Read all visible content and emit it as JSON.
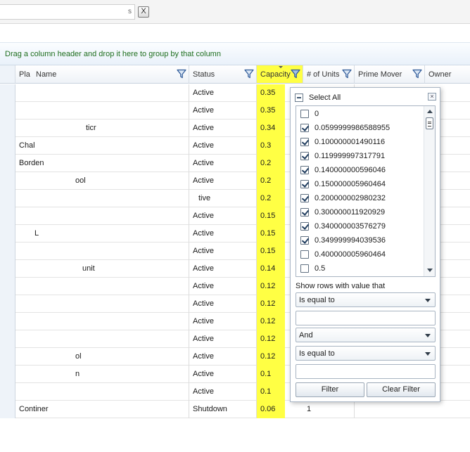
{
  "toolbar": {
    "search_value": "s",
    "clear_label": "X"
  },
  "group_panel": {
    "text": "Drag a column header and drop it here to group by that column"
  },
  "columns": {
    "plant": "Pla",
    "name": "Name",
    "status": "Status",
    "capacity": "Capacity",
    "units": "# of Units",
    "prime_mover": "Prime Mover",
    "owner": "Owner"
  },
  "rows": [
    {
      "name": "",
      "status": "Active",
      "capacity": "0.35",
      "units": ""
    },
    {
      "name": "",
      "status": "Active",
      "capacity": "0.35",
      "units": ""
    },
    {
      "name": "ticr",
      "status": "Active",
      "capacity": "0.34",
      "units": ""
    },
    {
      "name": "Chal",
      "status": "Active",
      "capacity": "0.3",
      "units": ""
    },
    {
      "name": "Borden",
      "status": "Active",
      "capacity": "0.2",
      "units": ""
    },
    {
      "name": "ool",
      "status": "Active",
      "capacity": "0.2",
      "units": ""
    },
    {
      "name": "",
      "status": "tive",
      "capacity": "0.2",
      "units": ""
    },
    {
      "name": "",
      "status": "Active",
      "capacity": "0.15",
      "units": ""
    },
    {
      "name": "L",
      "status": "Active",
      "capacity": "0.15",
      "units": ""
    },
    {
      "name": "",
      "status": "Active",
      "capacity": "0.15",
      "units": ""
    },
    {
      "name": "unit",
      "status": "Active",
      "capacity": "0.14",
      "units": ""
    },
    {
      "name": "",
      "status": "Active",
      "capacity": "0.12",
      "units": ""
    },
    {
      "name": "",
      "status": "Active",
      "capacity": "0.12",
      "units": ""
    },
    {
      "name": "",
      "status": "Active",
      "capacity": "0.12",
      "units": ""
    },
    {
      "name": "",
      "status": "Active",
      "capacity": "0.12",
      "units": ""
    },
    {
      "name": "ol",
      "status": "Active",
      "capacity": "0.12",
      "units": ""
    },
    {
      "name": "n",
      "status": "Active",
      "capacity": "0.1",
      "units": ""
    },
    {
      "name": "",
      "status": "Active",
      "capacity": "0.1",
      "units": ""
    },
    {
      "name": "Continer",
      "status": "Shutdown",
      "capacity": "0.06",
      "units": "1"
    }
  ],
  "filter": {
    "select_all": "Select All",
    "close_label": "×",
    "options": [
      {
        "label": "0",
        "checked": false
      },
      {
        "label": "0.0599999986588955",
        "checked": true
      },
      {
        "label": "0.100000001490116",
        "checked": true
      },
      {
        "label": "0.119999997317791",
        "checked": true
      },
      {
        "label": "0.140000000596046",
        "checked": true
      },
      {
        "label": "0.150000005960464",
        "checked": true
      },
      {
        "label": "0.200000002980232",
        "checked": true
      },
      {
        "label": "0.300000011920929",
        "checked": true
      },
      {
        "label": "0.340000003576279",
        "checked": true
      },
      {
        "label": "0.349999994039536",
        "checked": true
      },
      {
        "label": "0.400000005960464",
        "checked": false
      },
      {
        "label": "0.5",
        "checked": false
      }
    ],
    "show_rows_label": "Show rows with value that",
    "operator1": "Is equal to",
    "value1": "",
    "logic": "And",
    "operator2": "Is equal to",
    "value2": "",
    "filter_button": "Filter",
    "clear_button": "Clear Filter"
  },
  "colors": {
    "highlight": "#ffff44",
    "group_text": "#1e6e1e",
    "filter_icon": "#2b5797"
  }
}
